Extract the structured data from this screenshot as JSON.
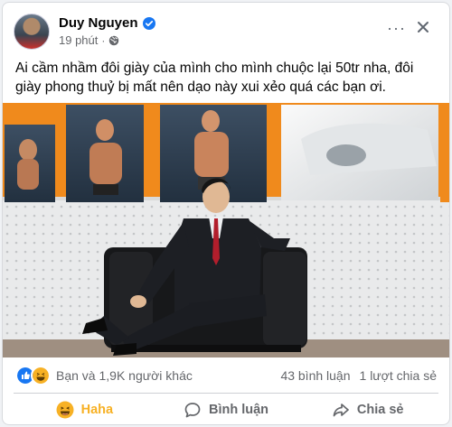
{
  "post": {
    "author": "Duy Nguyen",
    "time": "19 phút",
    "separator": "·",
    "text": "Ai cầm nhầm đôi giày của mình cho mình chuộc lại 50tr nha, đôi giày phong thuỷ bị mất nên dạo này xui xẻo quá các bạn ơi.",
    "more_label": "···"
  },
  "stats": {
    "reactions_text": "Bạn và 1,9K người khác",
    "comments": "43 bình luận",
    "shares": "1 lượt chia sẻ"
  },
  "actions": {
    "haha": "Haha",
    "comment": "Bình luận",
    "share": "Chia sẻ"
  },
  "colors": {
    "verified": "#1877f2",
    "haha": "#f7b125",
    "like": "#1877f2",
    "orange_wall": "#f08a1c"
  },
  "icons": [
    "verified-icon",
    "globe-icon",
    "more-icon",
    "close-icon",
    "like-reaction-icon",
    "haha-reaction-icon",
    "comment-icon",
    "share-icon"
  ]
}
